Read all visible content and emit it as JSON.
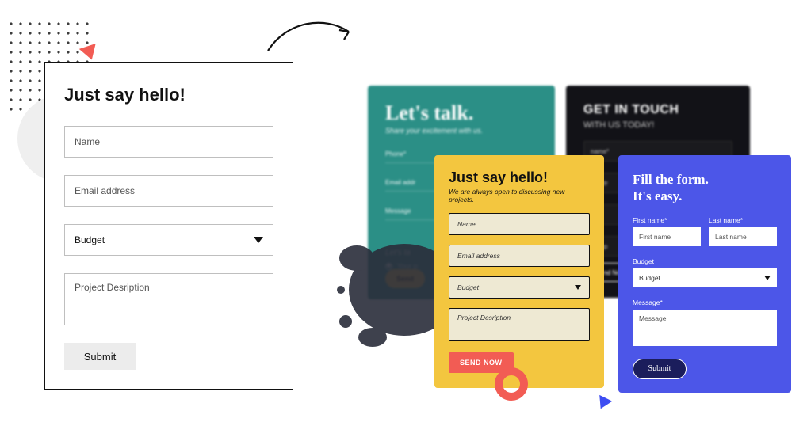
{
  "card1": {
    "title": "Just say hello!",
    "name_ph": "Name",
    "email_ph": "Email address",
    "budget_label": "Budget",
    "desc_ph": "Project Desription",
    "submit": "Submit"
  },
  "card2": {
    "title": "Let's talk.",
    "subtitle": "Share your excitement with us.",
    "phone": "Phone*",
    "email": "Email addr",
    "message": "Message",
    "footer": "Let's ta",
    "opt1": "Your p",
    "opt2": "Meeti",
    "send": "Send"
  },
  "card3": {
    "title": "GET IN TOUCH",
    "subtitle": "WITH US TODAY!",
    "r1": "name*",
    "r2": "il addr",
    "r3": "ge",
    "r4": "accep",
    "send": "nd No"
  },
  "card4": {
    "title": "Just say hello!",
    "subtitle": "We are always open to discussing new projects.",
    "name_ph": "Name",
    "email_ph": "Email address",
    "budget": "Budget",
    "desc_ph": "Project Desription",
    "send": "SEND NOW"
  },
  "card5": {
    "title_l1": "Fill the form.",
    "title_l2": "It's easy.",
    "fn_label": "First name*",
    "ln_label": "Last name*",
    "fn_ph": "First name",
    "ln_ph": "Last name",
    "budget_label": "Budget",
    "budget": "Budget",
    "msg_label": "Message*",
    "msg_ph": "Message",
    "submit": "Submit"
  }
}
